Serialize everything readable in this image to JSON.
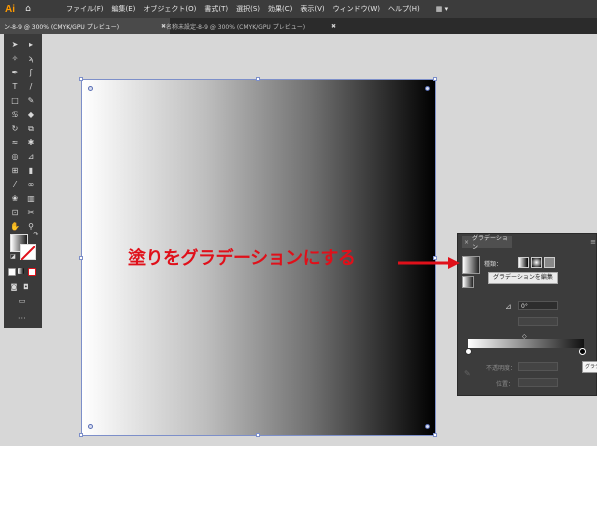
{
  "app": {
    "logo": "Ai",
    "home_icon": "home-icon"
  },
  "menu": [
    "ファイル(F)",
    "編集(E)",
    "オブジェクト(O)",
    "書式(T)",
    "選択(S)",
    "効果(C)",
    "表示(V)",
    "ウィンドウ(W)",
    "ヘルプ(H)"
  ],
  "workspace_icon": "▦ ▾",
  "tabs": [
    {
      "label": "ン-8-9 @ 300% (CMYK/GPU プレビュー)",
      "close": "✖"
    },
    {
      "label": "名称未設定-8-9 @ 300% (CMYK/GPU プレビュー)",
      "close": "✖"
    }
  ],
  "gradient_panel": {
    "tab_label": "グラデーション",
    "tab_close": "×",
    "menu": "≡",
    "kind_label": "種類：",
    "edit_button": "グラデーションを編集",
    "angle_icon": "⊿",
    "angle_value": "0°",
    "opacity_label": "不透明度：",
    "position_label": "位置：",
    "tooltip": "グラデ"
  },
  "annotation": {
    "text": "塗りをグラデーションにする",
    "color": "#e0101a"
  },
  "artboard": {
    "gradient_start": "#ffffff",
    "gradient_end": "#000000",
    "selection_color": "#7d8fc9"
  },
  "toolbox": {
    "more": "···"
  }
}
